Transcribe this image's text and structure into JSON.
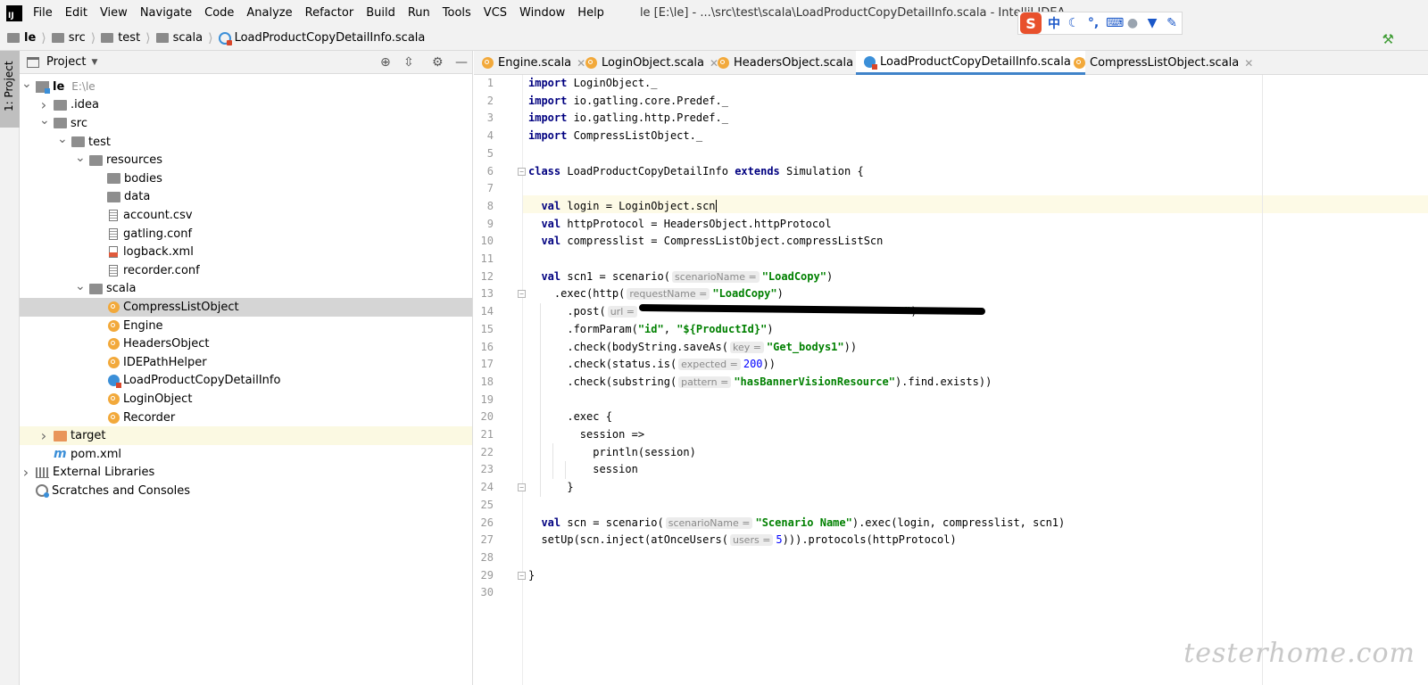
{
  "window": {
    "title": "le [E:\\le] - ...\\src\\test\\scala\\LoadProductCopyDetailInfo.scala - IntelliJ IDEA",
    "logo_text": "IJ"
  },
  "menu": [
    "File",
    "Edit",
    "View",
    "Navigate",
    "Code",
    "Analyze",
    "Refactor",
    "Build",
    "Run",
    "Tools",
    "VCS",
    "Window",
    "Help"
  ],
  "ime": {
    "logo": "S",
    "mode": "中"
  },
  "breadcrumb": [
    "le",
    "src",
    "test",
    "scala",
    "LoadProductCopyDetailInfo.scala"
  ],
  "tool_strip": {
    "project_tab": "1: Project"
  },
  "project": {
    "title": "Project",
    "tree": [
      {
        "label": "le",
        "hint": "E:\\le",
        "depth": 0,
        "arrow": "down",
        "icon": "module",
        "bold": true
      },
      {
        "label": ".idea",
        "depth": 1,
        "arrow": "right",
        "icon": "folder"
      },
      {
        "label": "src",
        "depth": 1,
        "arrow": "down",
        "icon": "folder"
      },
      {
        "label": "test",
        "depth": 2,
        "arrow": "down",
        "icon": "folder"
      },
      {
        "label": "resources",
        "depth": 3,
        "arrow": "down",
        "icon": "folder"
      },
      {
        "label": "bodies",
        "depth": 4,
        "arrow": "",
        "icon": "folder"
      },
      {
        "label": "data",
        "depth": 4,
        "arrow": "",
        "icon": "folder"
      },
      {
        "label": "account.csv",
        "depth": 4,
        "arrow": "",
        "icon": "file"
      },
      {
        "label": "gatling.conf",
        "depth": 4,
        "arrow": "",
        "icon": "file"
      },
      {
        "label": "logback.xml",
        "depth": 4,
        "arrow": "",
        "icon": "xml"
      },
      {
        "label": "recorder.conf",
        "depth": 4,
        "arrow": "",
        "icon": "file"
      },
      {
        "label": "scala",
        "depth": 3,
        "arrow": "down",
        "icon": "folder"
      },
      {
        "label": "CompressListObject",
        "depth": 4,
        "arrow": "",
        "icon": "obj",
        "selected": true
      },
      {
        "label": "Engine",
        "depth": 4,
        "arrow": "",
        "icon": "obj"
      },
      {
        "label": "HeadersObject",
        "depth": 4,
        "arrow": "",
        "icon": "obj"
      },
      {
        "label": "IDEPathHelper",
        "depth": 4,
        "arrow": "",
        "icon": "obj"
      },
      {
        "label": "LoadProductCopyDetailInfo",
        "depth": 4,
        "arrow": "",
        "icon": "cls"
      },
      {
        "label": "LoginObject",
        "depth": 4,
        "arrow": "",
        "icon": "obj"
      },
      {
        "label": "Recorder",
        "depth": 4,
        "arrow": "",
        "icon": "obj"
      },
      {
        "label": "target",
        "depth": 1,
        "arrow": "right",
        "icon": "folder-orange",
        "excluded": true
      },
      {
        "label": "pom.xml",
        "depth": 1,
        "arrow": "",
        "icon": "m"
      },
      {
        "label": "External Libraries",
        "depth": 0,
        "arrow": "right",
        "icon": "lib"
      },
      {
        "label": "Scratches and Consoles",
        "depth": 0,
        "arrow": "",
        "icon": "scratch"
      }
    ]
  },
  "tabs": [
    {
      "label": "Engine.scala",
      "icon": "obj",
      "active": false
    },
    {
      "label": "LoginObject.scala",
      "icon": "obj",
      "active": false
    },
    {
      "label": "HeadersObject.scala",
      "icon": "obj",
      "active": false
    },
    {
      "label": "LoadProductCopyDetailInfo.scala",
      "icon": "cls",
      "active": true
    },
    {
      "label": "CompressListObject.scala",
      "icon": "obj",
      "active": false
    }
  ],
  "code_lines": [
    [
      [
        "kw",
        "import"
      ],
      [
        "t",
        " LoginObject._"
      ]
    ],
    [
      [
        "kw",
        "import"
      ],
      [
        "t",
        " io.gatling.core.Predef._"
      ]
    ],
    [
      [
        "kw",
        "import"
      ],
      [
        "t",
        " io.gatling.http.Predef._"
      ]
    ],
    [
      [
        "kw",
        "import"
      ],
      [
        "t",
        " CompressListObject._"
      ]
    ],
    [],
    [
      [
        "kw",
        "class"
      ],
      [
        "t",
        " LoadProductCopyDetailInfo "
      ],
      [
        "kw",
        "extends"
      ],
      [
        "t",
        " Simulation {"
      ]
    ],
    [],
    [
      [
        "t",
        "  "
      ],
      [
        "kw",
        "val"
      ],
      [
        "t",
        " login = LoginObject.scn"
      ]
    ],
    [
      [
        "t",
        "  "
      ],
      [
        "kw",
        "val"
      ],
      [
        "t",
        " httpProtocol = HeadersObject.httpProtocol"
      ]
    ],
    [
      [
        "t",
        "  "
      ],
      [
        "kw",
        "val"
      ],
      [
        "t",
        " compresslist = CompressListObject.compressListScn"
      ]
    ],
    [],
    [
      [
        "t",
        "  "
      ],
      [
        "kw",
        "val"
      ],
      [
        "t",
        " scn1 = scenario("
      ],
      [
        "hint",
        "scenarioName ="
      ],
      [
        "str",
        "\"LoadCopy\""
      ],
      [
        "t",
        ")"
      ]
    ],
    [
      [
        "t",
        "    .exec(http("
      ],
      [
        "hint",
        "requestName ="
      ],
      [
        "str",
        "\"LoadCopy\""
      ],
      [
        "t",
        ")"
      ]
    ],
    [
      [
        "t",
        "      .post("
      ],
      [
        "hint",
        "url ="
      ],
      [
        "str",
        "\"                                        \""
      ],
      [
        "t",
        ")"
      ]
    ],
    [
      [
        "t",
        "      .formParam("
      ],
      [
        "str",
        "\"id\""
      ],
      [
        "t",
        ", "
      ],
      [
        "str",
        "\"${ProductId}\""
      ],
      [
        "t",
        ")"
      ]
    ],
    [
      [
        "t",
        "      .check(bodyString.saveAs("
      ],
      [
        "hint",
        "key ="
      ],
      [
        "str",
        "\"Get_bodys1\""
      ],
      [
        "t",
        "))"
      ]
    ],
    [
      [
        "t",
        "      .check(status.is("
      ],
      [
        "hint",
        "expected ="
      ],
      [
        "num",
        "200"
      ],
      [
        "t",
        "))"
      ]
    ],
    [
      [
        "t",
        "      .check(substring("
      ],
      [
        "hint",
        "pattern ="
      ],
      [
        "str",
        "\"hasBannerVisionResource\""
      ],
      [
        "t",
        ").find.exists))"
      ]
    ],
    [],
    [
      [
        "t",
        "      .exec {"
      ]
    ],
    [
      [
        "t",
        "        session =>"
      ]
    ],
    [
      [
        "t",
        "          println(session)"
      ]
    ],
    [
      [
        "t",
        "          session"
      ]
    ],
    [
      [
        "t",
        "      }"
      ]
    ],
    [],
    [
      [
        "t",
        "  "
      ],
      [
        "kw",
        "val"
      ],
      [
        "t",
        " scn = scenario("
      ],
      [
        "hint",
        "scenarioName ="
      ],
      [
        "str",
        "\"Scenario Name\""
      ],
      [
        "t",
        ").exec(login, compresslist, scn1)"
      ]
    ],
    [
      [
        "t",
        "  setUp(scn.inject(atOnceUsers("
      ],
      [
        "hint",
        "users ="
      ],
      [
        "num",
        "5"
      ],
      [
        "t",
        "))).protocols(httpProtocol)"
      ]
    ],
    [],
    [
      [
        "t",
        "}"
      ]
    ],
    []
  ],
  "watermark": "testerhome.com",
  "colors": {
    "accent": "#4083c9",
    "selection": "#d5d5d5",
    "current_line": "#fdfae6",
    "keyword": "#000080",
    "string": "#008000"
  }
}
